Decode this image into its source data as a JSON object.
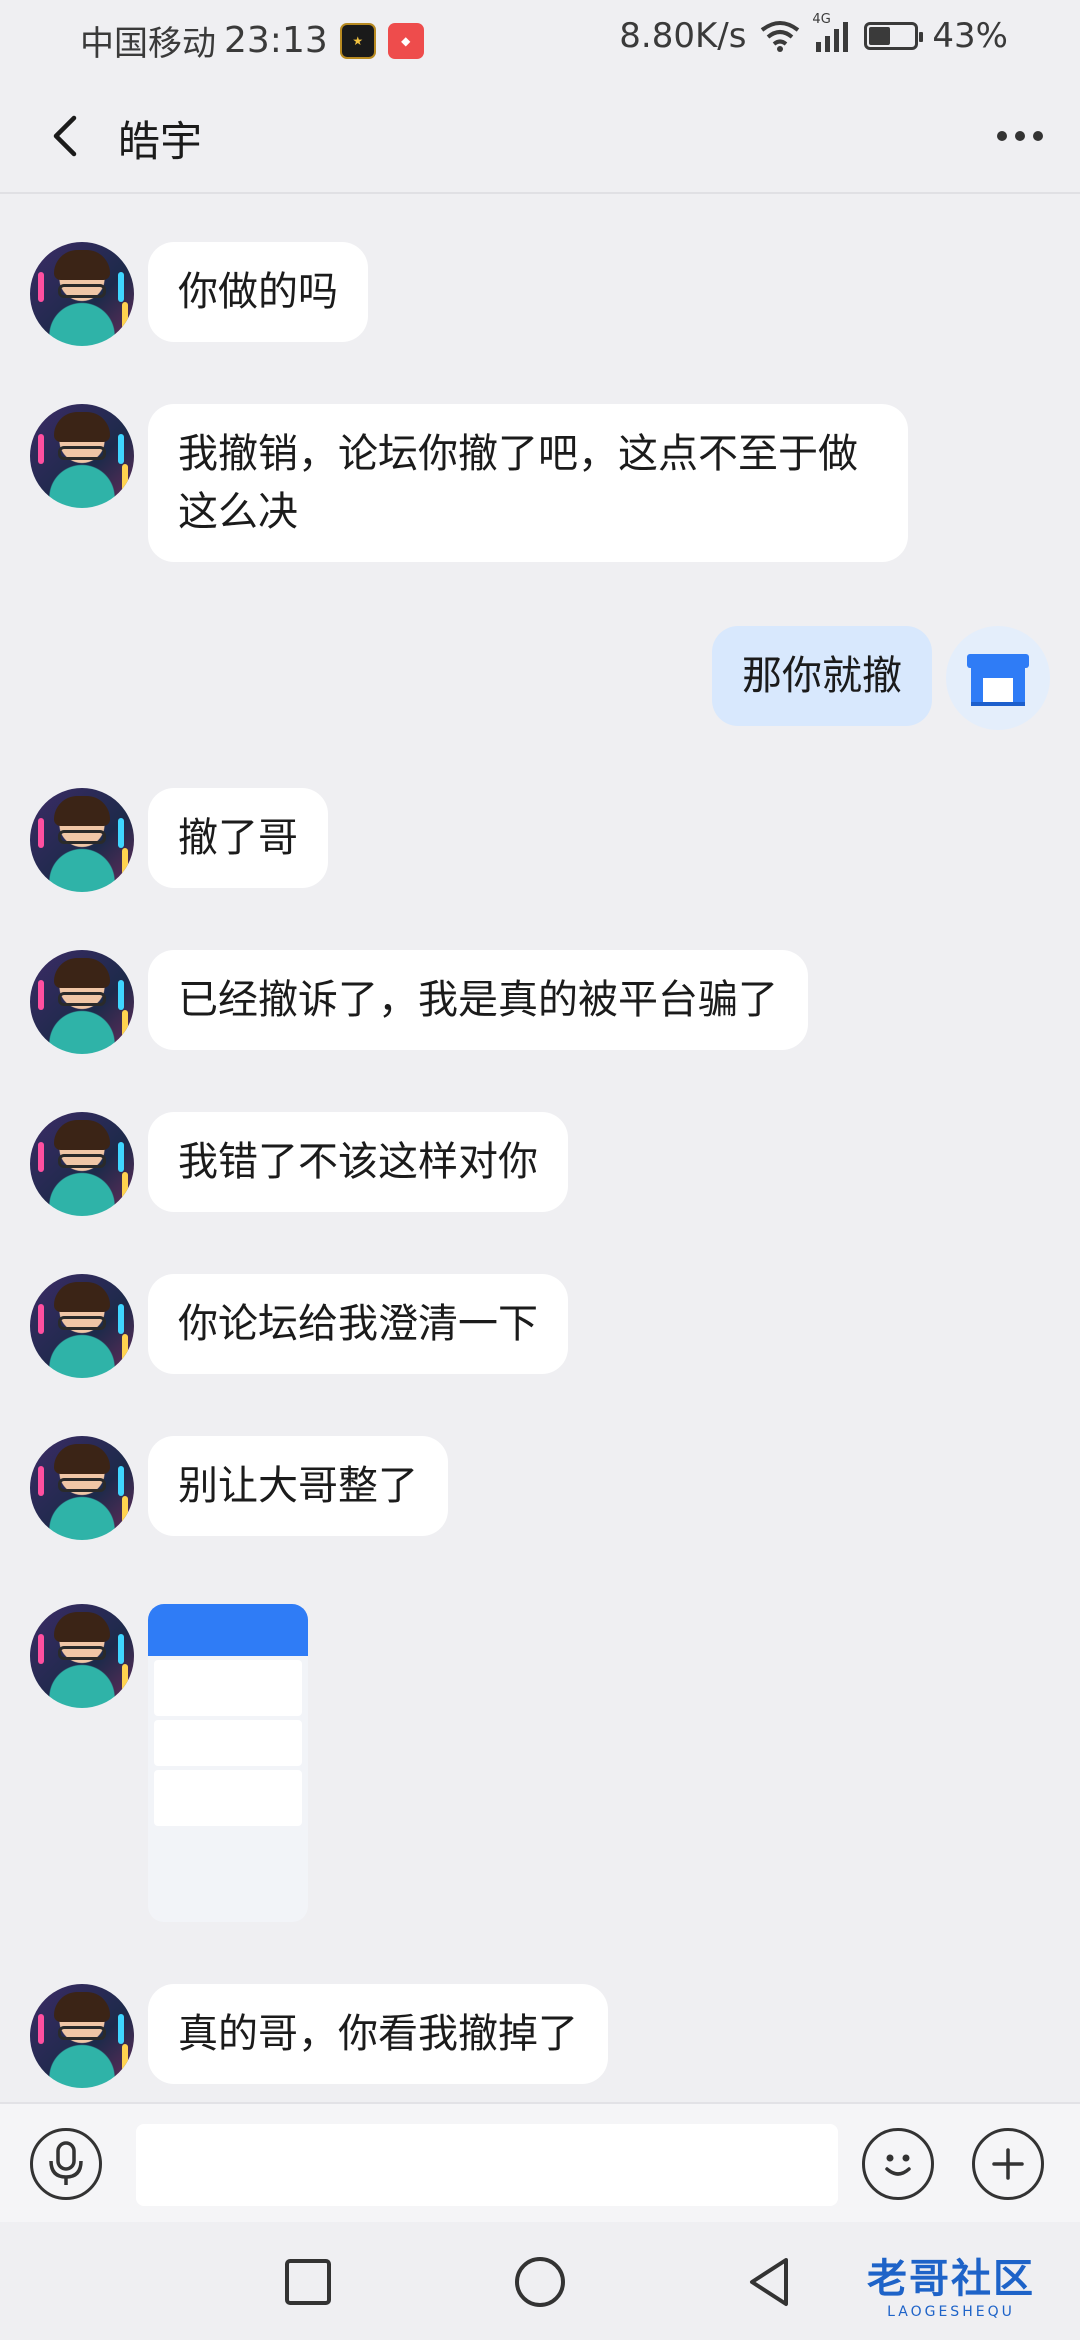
{
  "status_bar": {
    "carrier": "中国移动",
    "time": "23:13",
    "network_speed": "8.80K/s",
    "signal_type": "4G",
    "battery": "43%",
    "battery_level": 0.43,
    "icons": [
      "app-badge-icon",
      "app-badge-icon",
      "wifi-icon",
      "cell-signal-icon",
      "battery-charging-icon"
    ]
  },
  "header": {
    "title": "皓宇"
  },
  "messages": [
    {
      "side": "in",
      "text": "你做的吗"
    },
    {
      "side": "in",
      "text": "我撤销，论坛你撤了吧，这点不至于做这么决"
    },
    {
      "side": "out",
      "text": "那你就撤"
    },
    {
      "side": "in",
      "text": "撤了哥"
    },
    {
      "side": "in",
      "text": "已经撤诉了，我是真的被平台骗了"
    },
    {
      "side": "in",
      "text": "我错了不该这样对你"
    },
    {
      "side": "in",
      "text": "你论坛给我澄清一下"
    },
    {
      "side": "in",
      "text": "别让大哥整了"
    },
    {
      "side": "in",
      "type": "image"
    },
    {
      "side": "in",
      "text": "真的哥，你看我撤掉了"
    }
  ],
  "input_bar": {
    "placeholder": "",
    "icons": [
      "microphone-icon",
      "emoji-icon",
      "plus-icon"
    ]
  },
  "navigation": {
    "icons": [
      "recent-apps-icon",
      "home-icon",
      "back-icon"
    ]
  },
  "watermark": {
    "title": "老哥社区",
    "subtitle": "LAOGESHEQU"
  },
  "colors": {
    "background": "#efeff2",
    "incoming_bubble": "#ffffff",
    "outgoing_bubble": "#d8e8fd",
    "watermark": "#1e63c8"
  }
}
